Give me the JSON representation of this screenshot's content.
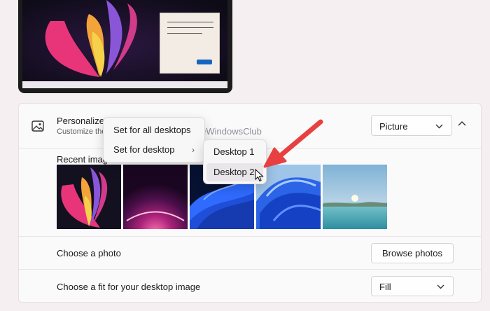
{
  "personalize": {
    "title": "Personalize your background",
    "subtitle": "Customize the",
    "dropdown_value": "Picture",
    "recent_label": "Recent images",
    "thumbnails": [
      "image-1",
      "image-2",
      "image-3",
      "image-4",
      "image-5"
    ]
  },
  "rows": {
    "choose_photo_label": "Choose a photo",
    "browse_label": "Browse photos",
    "fit_label": "Choose a fit for your desktop image",
    "fit_value": "Fill"
  },
  "context_menu": {
    "item_all": "Set for all desktops",
    "item_desktop": "Set for desktop",
    "submenu": [
      "Desktop 1",
      "Desktop 2"
    ]
  },
  "watermark": {
    "text": "TheWindowsClub"
  },
  "colors": {
    "accent": "#1565c0",
    "arrow": "#e84040",
    "background": "#f5eff2"
  }
}
